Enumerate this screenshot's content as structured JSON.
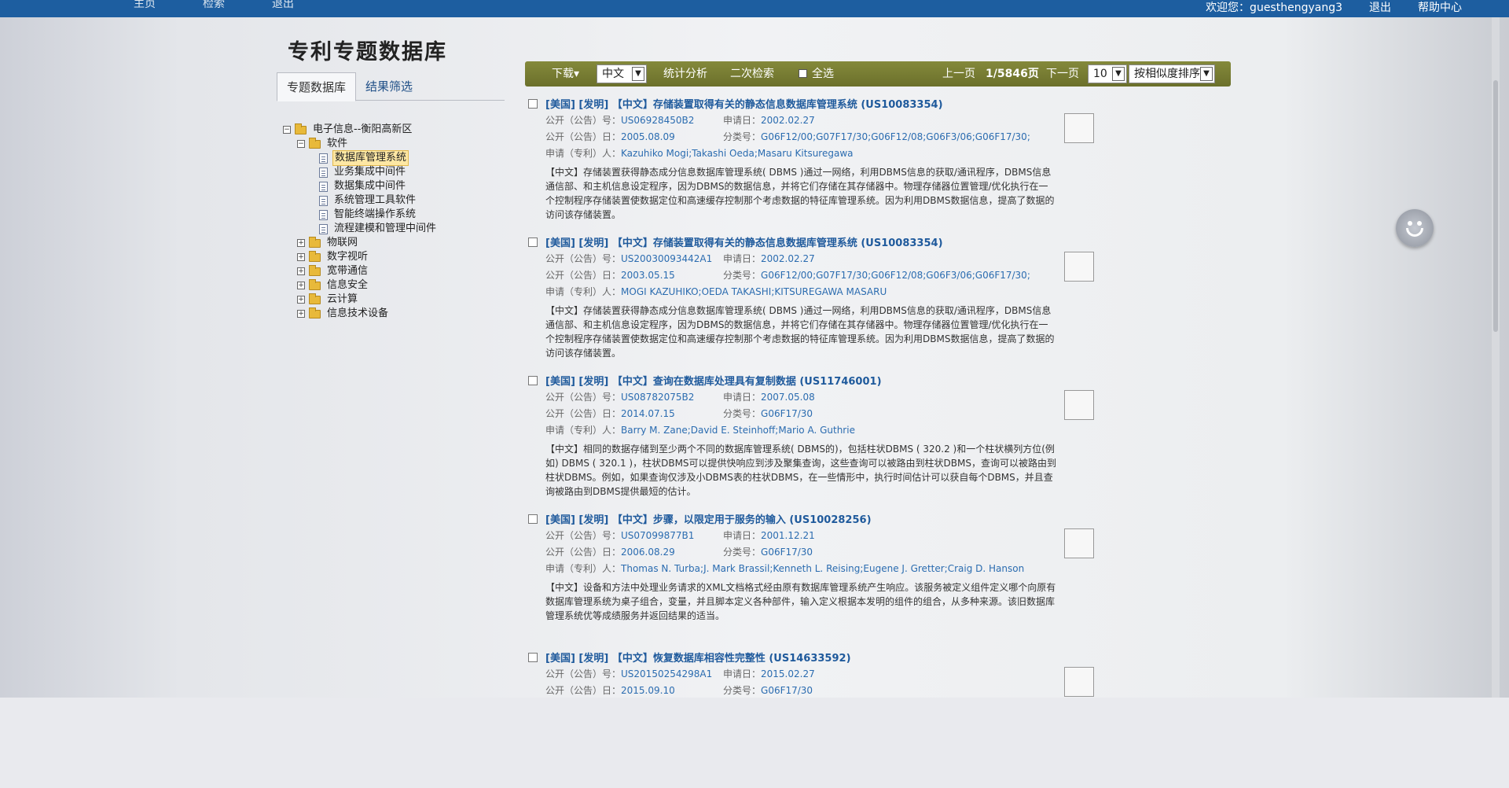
{
  "topbar": {
    "nav": [
      "主页",
      "检索",
      "退出"
    ],
    "welcome": "欢迎您：guesthengyang3",
    "logout": "退出",
    "help": "帮助中心"
  },
  "page_title": "专利专题数据库",
  "tabs": [
    "专题数据库",
    "结果筛选"
  ],
  "tree": {
    "root": "电子信息--衡阳高新区",
    "software": "软件",
    "software_items": [
      "数据库管理系统",
      "业务集成中间件",
      "数据集成中间件",
      "系统管理工具软件",
      "智能终端操作系统",
      "流程建模和管理中间件"
    ],
    "others": [
      "物联网",
      "数字视听",
      "宽带通信",
      "信息安全",
      "云计算",
      "信息技术设备"
    ]
  },
  "toolbar": {
    "download": "下载▾",
    "language": "中文",
    "stats": "统计分析",
    "secondary_search": "二次检索",
    "select_all": "全选",
    "prev": "上一页",
    "page_info": "1/5846页",
    "next": "下一页",
    "page_size": "10",
    "sort": "按相似度排序"
  },
  "labels": {
    "pub_no": "公开（公告）号：",
    "app_date": "申请日：",
    "pub_date": "公开（公告）日：",
    "class_no": "分类号：",
    "applicant": "申请（专利）人："
  },
  "results": [
    {
      "title": "[美国] [发明] 【中文】存储装置取得有关的静态信息数据库管理系统 (US10083354)",
      "pub_no": "US06928450B2",
      "app_date": "2002.02.27",
      "pub_date": "2005.08.09",
      "class_no": "G06F12/00;G07F17/30;G06F12/08;G06F3/06;G06F17/30;",
      "applicant": "Kazuhiko Mogi;Takashi Oeda;Masaru Kitsuregawa",
      "abstract": "【中文】存储装置获得静态成分信息数据库管理系统( DBMS )通过一网络，利用DBMS信息的获取/通讯程序，DBMS信息通信部、和主机信息设定程序，因为DBMS的数据信息，并将它们存储在其存储器中。物理存储器位置管理/优化执行在一个控制程序存储装置使数据定位和高速缓存控制那个考虑数据的特征库管理系统。因为利用DBMS数据信息，提高了数据的访问该存储装置。"
    },
    {
      "title": "[美国] [发明] 【中文】存储装置取得有关的静态信息数据库管理系统 (US10083354)",
      "pub_no": "US20030093442A1",
      "app_date": "2002.02.27",
      "pub_date": "2003.05.15",
      "class_no": "G06F12/00;G07F17/30;G06F12/08;G06F3/06;G06F17/30;",
      "applicant": "MOGI KAZUHIKO;OEDA TAKASHI;KITSUREGAWA MASARU",
      "abstract": "【中文】存储装置获得静态成分信息数据库管理系统( DBMS )通过一网络，利用DBMS信息的获取/通讯程序，DBMS信息通信部、和主机信息设定程序，因为DBMS的数据信息，并将它们存储在其存储器中。物理存储器位置管理/优化执行在一个控制程序存储装置使数据定位和高速缓存控制那个考虑数据的特征库管理系统。因为利用DBMS数据信息，提高了数据的访问该存储装置。"
    },
    {
      "title": "[美国] [发明] 【中文】查询在数据库处理具有复制数据 (US11746001)",
      "pub_no": "US08782075B2",
      "app_date": "2007.05.08",
      "pub_date": "2014.07.15",
      "class_no": "G06F17/30",
      "applicant": "Barry M. Zane;David E. Steinhoff;Mario A. Guthrie",
      "abstract": "【中文】相同的数据存储到至少两个不同的数据库管理系统( DBMS的)，包括柱状DBMS ( 320.2 )和一个柱状横列方位(例如) DBMS ( 320.1 )，柱状DBMS可以提供快响应到涉及聚集查询，这些查询可以被路由到柱状DBMS，查询可以被路由到柱状DBMS。例如，如果查询仅涉及小DBMS表的柱状DBMS，在一些情形中，执行时间估计可以获自每个DBMS，并且查询被路由到DBMS提供最短的估计。"
    },
    {
      "title": "[美国] [发明] 【中文】步骤，以限定用于服务的输入 (US10028256)",
      "pub_no": "US07099877B1",
      "app_date": "2001.12.21",
      "pub_date": "2006.08.29",
      "class_no": "G06F17/30",
      "applicant": "Thomas N. Turba;J. Mark Brassil;Kenneth L. Reising;Eugene J. Gretter;Craig D. Hanson",
      "abstract": "【中文】设备和方法中处理业务请求的XML文档格式经由原有数据库管理系统产生响应。该服务被定义组件定义哪个向原有数据库管理系统为桌子组合，变量，并且脚本定义各种部件，输入定义根据本发明的组件的组合，从多种来源。该旧数据库管理系统优等成绩服务并返回结果的适当。"
    },
    {
      "title": "[美国] [发明] 【中文】恢复数据库相容性完整性 (US14633592)",
      "pub_no": "US20150254298A1",
      "app_date": "2015.02.27",
      "pub_date": "2015.09.10",
      "class_no": "G06F17/30",
      "applicant": "",
      "abstract": ""
    }
  ]
}
